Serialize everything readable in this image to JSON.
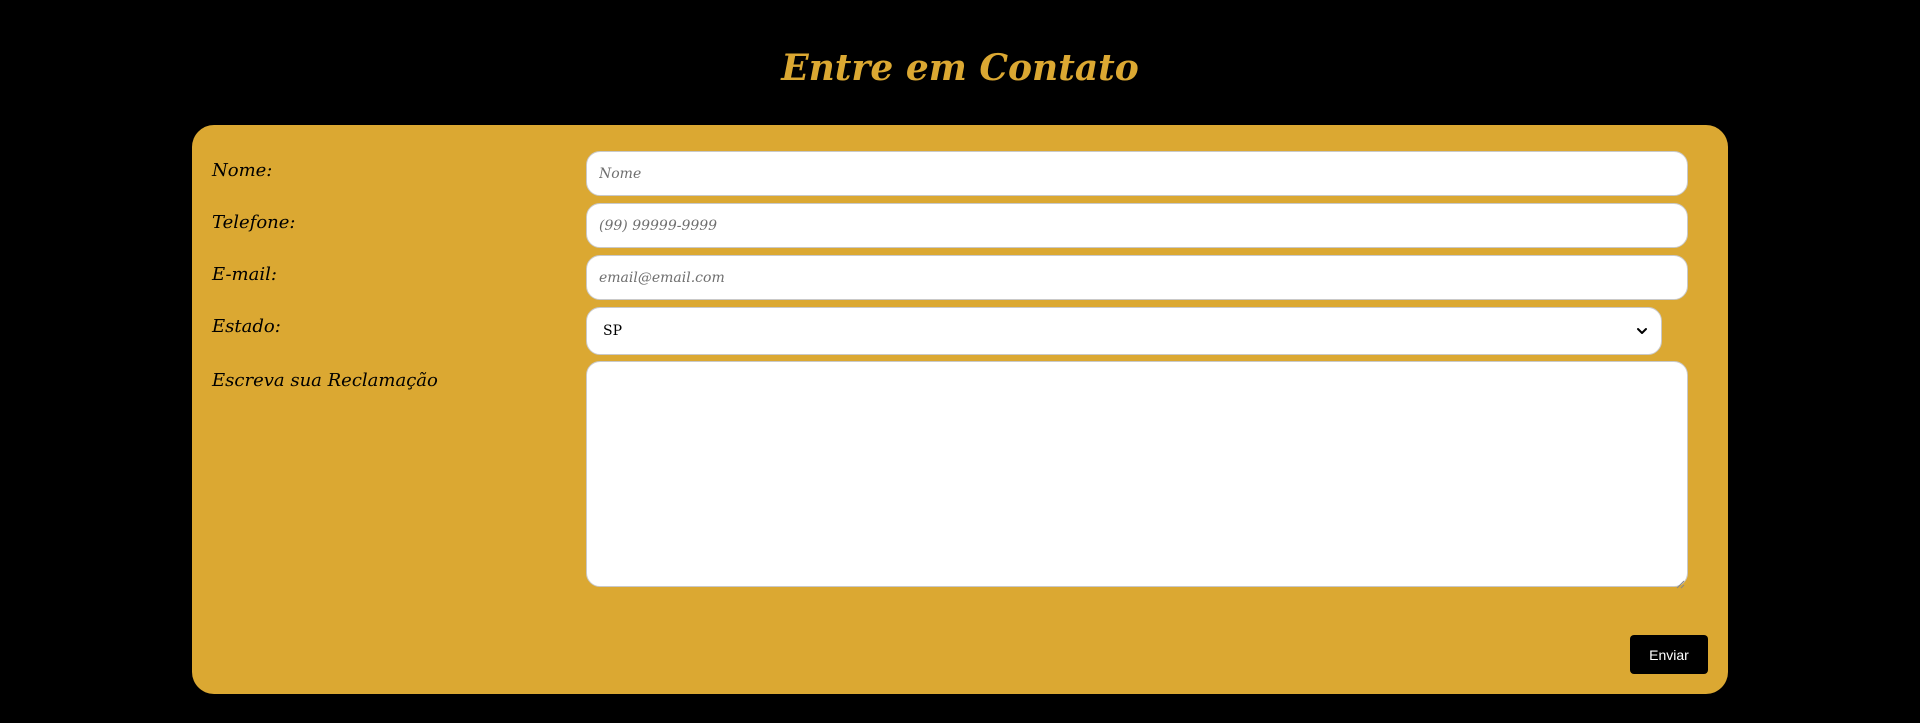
{
  "page": {
    "title": "Entre em Contato"
  },
  "form": {
    "name": {
      "label": "Nome:",
      "placeholder": "Nome",
      "value": ""
    },
    "phone": {
      "label": "Telefone:",
      "placeholder": "(99) 99999-9999",
      "value": ""
    },
    "email": {
      "label": "E-mail:",
      "placeholder": "email@email.com",
      "value": ""
    },
    "state": {
      "label": "Estado:",
      "selected": "SP",
      "icon": "chevron-down-icon"
    },
    "complaint": {
      "label": "Escreva sua Reclamação",
      "value": ""
    },
    "submit_label": "Enviar"
  },
  "colors": {
    "background": "#000000",
    "accent": "#dba832",
    "field_background": "#ffffff",
    "button_background": "#000000",
    "button_text": "#ffffff"
  }
}
